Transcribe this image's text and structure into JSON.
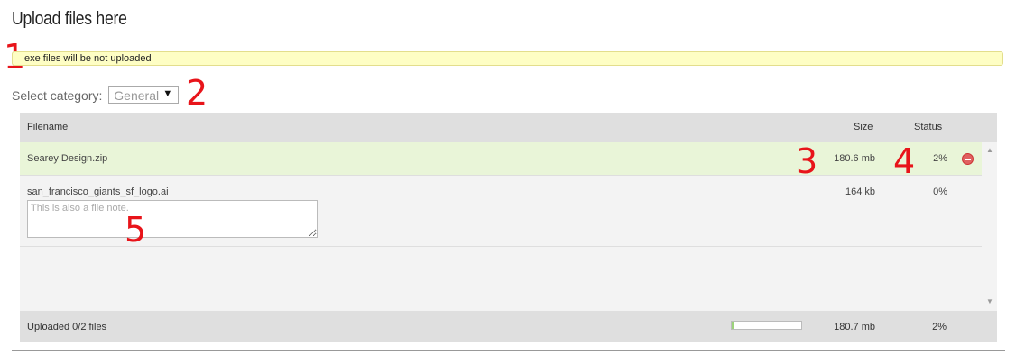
{
  "page_title": "Upload files here",
  "notice": "exe files will be not uploaded",
  "category": {
    "label": "Select category:",
    "selected": "General"
  },
  "table": {
    "headers": {
      "filename": "Filename",
      "size": "Size",
      "status": "Status"
    },
    "files": [
      {
        "name": "Searey Design.zip",
        "size": "180.6 mb",
        "status": "2%"
      },
      {
        "name": "san_francisco_giants_sf_logo.ai",
        "size": "164 kb",
        "status": "0%",
        "note_placeholder": "This is also a file note."
      }
    ],
    "footer": {
      "count": "Uploaded 0/2 files",
      "progress": 0.02,
      "total_size": "180.7 mb",
      "total_status": "2%"
    }
  },
  "callouts": {
    "c1": "1",
    "c2": "2",
    "c3": "3",
    "c4": "4",
    "c5": "5"
  },
  "colors": {
    "notice_bg": "#fefec4",
    "active_row": "#e9f5d8",
    "callout": "#e8141a",
    "remove_icon": "#e06060"
  }
}
